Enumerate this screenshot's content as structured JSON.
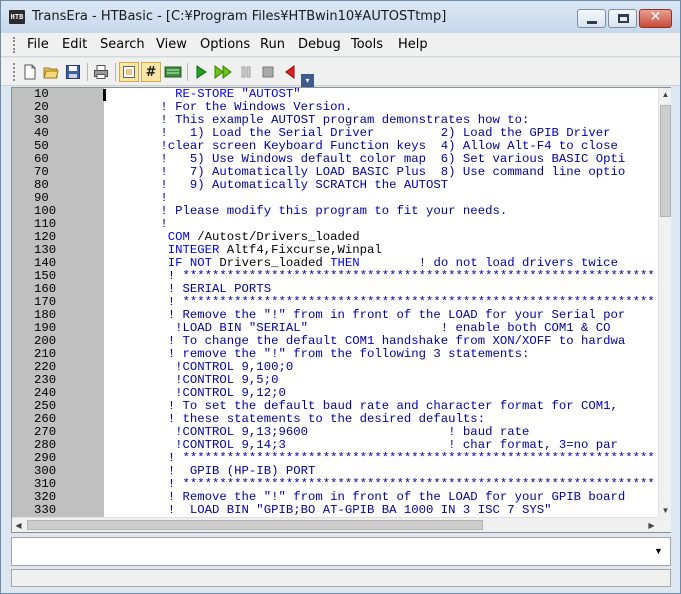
{
  "window": {
    "app_icon_text": "HTB",
    "title": "TransEra - HTBasic - [C:¥Program Files¥HTBwin10¥AUTOSTtmp]",
    "close_glyph": "✕"
  },
  "menu": {
    "items": [
      "File",
      "Edit",
      "Search",
      "View",
      "Options",
      "Run",
      "Debug",
      "Tools",
      "Help"
    ]
  },
  "toolbar": {
    "icons": [
      "new-file-icon",
      "open-folder-icon",
      "save-disk-icon",
      "print-icon",
      "edit-mode-icon",
      "line-numbers-icon",
      "keyboard-icon",
      "run-icon",
      "continue-icon",
      "pause-icon",
      "stop-icon",
      "step-back-icon"
    ],
    "line_numbers_glyph": "#",
    "overflow_glyph": "▾"
  },
  "scroll": {
    "up": "▲",
    "down": "▼",
    "left": "◀",
    "right": "▶"
  },
  "editor": {
    "lines": [
      {
        "n": "10",
        "t": "   RE-STORE \"AUTOST\"",
        "k": "kw"
      },
      {
        "n": "20",
        "t": " ! For the Windows Version.",
        "k": "comment"
      },
      {
        "n": "30",
        "t": " ! This example AUTOST program demonstrates how to:",
        "k": "comment"
      },
      {
        "n": "40",
        "t": " !   1) Load the Serial Driver         2) Load the GPIB Driver",
        "k": "comment"
      },
      {
        "n": "50",
        "t": " !clear screen Keyboard Function keys  4) Allow Alt-F4 to close",
        "k": "comment"
      },
      {
        "n": "60",
        "t": " !   5) Use Windows default color map  6) Set various BASIC Opti",
        "k": "comment"
      },
      {
        "n": "70",
        "t": " !   7) Automatically LOAD BASIC Plus  8) Use command line optio",
        "k": "comment"
      },
      {
        "n": "80",
        "t": " !   9) Automatically SCRATCH the AUTOST",
        "k": "comment"
      },
      {
        "n": "90",
        "t": " !",
        "k": "comment"
      },
      {
        "n": "100",
        "t": " ! Please modify this program to fit your needs.",
        "k": "comment"
      },
      {
        "n": "110",
        "t": " !",
        "k": "comment"
      },
      {
        "n": "120",
        "t": "  COM /Autost/Drivers_loaded",
        "k": "mixed",
        "kw": "COM",
        "rest": " /Autost/Drivers_loaded"
      },
      {
        "n": "130",
        "t": "  INTEGER Altf4,Fixcurse,Winpal",
        "k": "mixed",
        "kw": "INTEGER",
        "rest": " Altf4,Fixcurse,Winpal"
      },
      {
        "n": "140",
        "t": "  IF NOT Drivers_loaded THEN        ! do not load drivers twice",
        "k": "if"
      },
      {
        "n": "150",
        "t": "  ! ****************************************************************",
        "k": "comment"
      },
      {
        "n": "160",
        "t": "  ! SERIAL PORTS",
        "k": "comment"
      },
      {
        "n": "170",
        "t": "  ! ****************************************************************",
        "k": "comment"
      },
      {
        "n": "180",
        "t": "  ! Remove the \"!\" from in front of the LOAD for your Serial por",
        "k": "comment"
      },
      {
        "n": "190",
        "t": "   !LOAD BIN \"SERIAL\"                  ! enable both COM1 & CO",
        "k": "comment"
      },
      {
        "n": "200",
        "t": "  ! To change the default COM1 handshake from XON/XOFF to hardwa",
        "k": "comment"
      },
      {
        "n": "210",
        "t": "  ! remove the \"!\" from the following 3 statements:",
        "k": "comment"
      },
      {
        "n": "220",
        "t": "   !CONTROL 9,100;0",
        "k": "comment"
      },
      {
        "n": "230",
        "t": "   !CONTROL 9,5;0",
        "k": "comment"
      },
      {
        "n": "240",
        "t": "   !CONTROL 9,12;0",
        "k": "comment"
      },
      {
        "n": "250",
        "t": "  ! To set the default baud rate and character format for COM1,",
        "k": "comment"
      },
      {
        "n": "260",
        "t": "  ! these statements to the desired defaults:",
        "k": "comment"
      },
      {
        "n": "270",
        "t": "   !CONTROL 9,13;9600                   ! baud rate",
        "k": "comment"
      },
      {
        "n": "280",
        "t": "   !CONTROL 9,14;3                      ! char format, 3=no par",
        "k": "comment"
      },
      {
        "n": "290",
        "t": "  ! ****************************************************************",
        "k": "comment"
      },
      {
        "n": "300",
        "t": "  !  GPIB (HP-IB) PORT",
        "k": "comment"
      },
      {
        "n": "310",
        "t": "  ! ****************************************************************",
        "k": "comment"
      },
      {
        "n": "320",
        "t": "  ! Remove the \"!\" from in front of the LOAD for your GPIB board",
        "k": "comment"
      },
      {
        "n": "330",
        "t": "  !  LOAD BIN \"GPIB;BO AT-GPIB BA 1000 IN 3 ISC 7 SYS\"",
        "k": "comment"
      }
    ]
  },
  "command_line": {
    "value": "",
    "dropdown_glyph": "▼"
  },
  "status_bar": {
    "text": ""
  }
}
